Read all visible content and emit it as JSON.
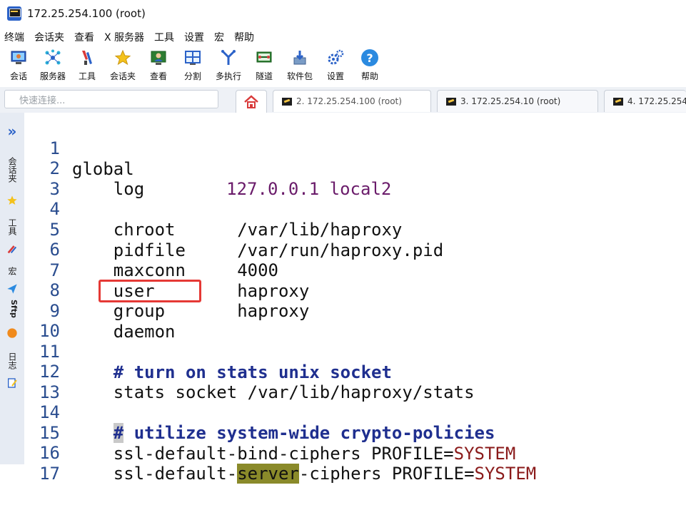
{
  "window": {
    "title": "172.25.254.100 (root)"
  },
  "menu": [
    "终端",
    "会话夹",
    "查看",
    "X 服务器",
    "工具",
    "设置",
    "宏",
    "帮助"
  ],
  "toolbar": [
    {
      "label": "会话",
      "icon": "session-icon"
    },
    {
      "label": "服务器",
      "icon": "servers-icon"
    },
    {
      "label": "工具",
      "icon": "tools-icon"
    },
    {
      "label": "会话夹",
      "icon": "star-icon"
    },
    {
      "label": "查看",
      "icon": "view-icon"
    },
    {
      "label": "分割",
      "icon": "split-icon"
    },
    {
      "label": "多执行",
      "icon": "multiexec-icon"
    },
    {
      "label": "隧道",
      "icon": "tunnel-icon"
    },
    {
      "label": "软件包",
      "icon": "packages-icon"
    },
    {
      "label": "设置",
      "icon": "gear-icon"
    },
    {
      "label": "帮助",
      "icon": "help-icon"
    }
  ],
  "quick_connect": {
    "placeholder": "快速连接..."
  },
  "tabs": [
    {
      "label": "2. 172.25.254.100 (root)",
      "active": true
    },
    {
      "label": "3. 172.25.254.10 (root)",
      "active": false
    },
    {
      "label": "4. 172.25.254",
      "active": false
    }
  ],
  "sidebar": {
    "items": [
      "会话夹",
      "工具",
      "宏",
      "Sftp",
      "日志"
    ]
  },
  "editor": {
    "lines": [
      {
        "n": "1",
        "text": "global"
      },
      {
        "n": "2",
        "key": "    log",
        "value": "127.0.0.1 local2"
      },
      {
        "n": "3",
        "text": ""
      },
      {
        "n": "4",
        "text": "    chroot      /var/lib/haproxy"
      },
      {
        "n": "5",
        "text": "    pidfile     /var/run/haproxy.pid"
      },
      {
        "n": "6",
        "text": "    maxconn     4000"
      },
      {
        "n": "7",
        "text": "    user        haproxy"
      },
      {
        "n": "8",
        "text": "    group       haproxy"
      },
      {
        "n": "9",
        "text": "    daemon"
      },
      {
        "n": "10",
        "text": ""
      },
      {
        "n": "11",
        "comment": "    # turn on stats unix socket"
      },
      {
        "n": "12",
        "text": "    stats socket /var/lib/haproxy/stats"
      },
      {
        "n": "13",
        "text": ""
      },
      {
        "n": "14",
        "hash": "#",
        "comment": " utilize system-wide crypto-policies"
      },
      {
        "n": "15",
        "pre": "    ssl-default-bind-ciphers PROFILE=",
        "sys": "SYSTEM"
      },
      {
        "n": "16",
        "pre1": "    ssl-default-",
        "hl": "server",
        "pre2": "-ciphers PROFILE=",
        "sys": "SYSTEM"
      },
      {
        "n": "17",
        "text": ""
      }
    ]
  },
  "colors": {
    "accent": "#2b62c8",
    "annotation_box": "#e53935"
  }
}
